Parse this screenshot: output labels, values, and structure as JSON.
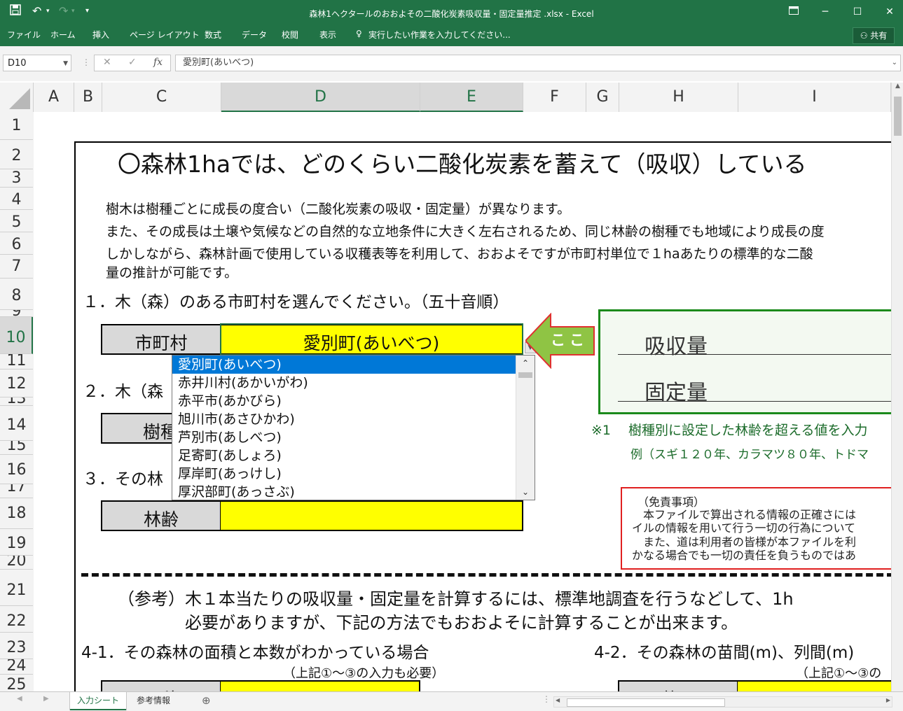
{
  "window": {
    "title": "森林1ヘクタールのおおよその二酸化炭素吸収量・固定量推定 .xlsx - Excel"
  },
  "ribbon": {
    "tabs": [
      "ファイル",
      "ホーム",
      "挿入",
      "ページ レイアウト",
      "数式",
      "データ",
      "校閲",
      "表示"
    ],
    "tell_me": "実行したい作業を入力してください...",
    "share": "共有"
  },
  "formula_bar": {
    "name_box": "D10",
    "content": "愛別町(あいべつ)"
  },
  "columns": [
    "A",
    "B",
    "C",
    "D",
    "E",
    "F",
    "G",
    "H",
    "I"
  ],
  "rows": [
    "1",
    "2",
    "3",
    "4",
    "5",
    "6",
    "7",
    "8",
    "9",
    "10",
    "11",
    "12",
    "13",
    "14",
    "15",
    "16",
    "17",
    "18",
    "19",
    "20",
    "21",
    "22",
    "23",
    "24",
    "25"
  ],
  "selected": {
    "column": "D",
    "row": "10"
  },
  "sheet": {
    "heading": "〇森林1haでは、どのくらい二酸化炭素を蓄えて（吸収）している",
    "intro_1": "樹木は樹種ごとに成長の度合い（二酸化炭素の吸収・固定量）が異なります。",
    "intro_2": "また、その成長は土壌や気候などの自然的な立地条件に大きく左右されるため、同じ林齢の樹種でも地域により成長の度",
    "intro_3": "しかしながら、森林計画で使用している収穫表等を利用して、おおよそですが市町村単位で１haあたりの標準的な二酸",
    "intro_4": "量の推計が可能です。",
    "step1": "１．木（森）のある市町村を選んでください。（五十音順）",
    "label_municipality": "市町村",
    "value_municipality": "愛別町(あいべつ)",
    "arrow_text": "ここ",
    "step2": "２．木（森",
    "label_species": "樹種",
    "step3": "３．その林",
    "label_age": "林齢",
    "result_absorb": "吸収量",
    "result_fixed": "固定量",
    "note1": "※1　 樹種別に設定した林齢を超える値を入力",
    "note2": "例（スギ１２０年、カラマツ８０年、トドマ",
    "disclaimer_title": "（免責事項）",
    "disclaimer_1": "本ファイルで算出される情報の正確さには",
    "disclaimer_2": "イルの情報を用いて行う一切の行為について",
    "disclaimer_3": "また、道は利用者の皆様が本ファイルを利",
    "disclaimer_4": "かなる場合でも一切の責任を負うものではあ",
    "ref_1": "（参考）木１本当たりの吸収量・固定量を計算するには、標準地調査を行うなどして、1h",
    "ref_2": "必要がありますが、下記の方法でもおおよそに計算することが出来ます。",
    "step41": "4-1．その森林の面積と本数がわかっている場合",
    "step41_sub": "（上記①～③の入力も必要）",
    "step42": "4-2．その森林の苗間(m)、列間(m)",
    "step42_sub": "（上記①～③の",
    "label_area": "面積",
    "label_spacing": "苗間"
  },
  "dropdown": {
    "items": [
      "愛別町(あいべつ)",
      "赤井川村(あかいがわ)",
      "赤平市(あかびら)",
      "旭川市(あさひかわ)",
      "芦別市(あしべつ)",
      "足寄町(あしょろ)",
      "厚岸町(あっけし)",
      "厚沢部町(あっさぶ)"
    ],
    "selected_index": 0
  },
  "sheet_tabs": [
    "入力シート",
    "参考情報"
  ],
  "active_sheet": "入力シート",
  "colors": {
    "excel_green": "#217346",
    "input_yellow": "#ffff00",
    "label_gray": "#d9d9d9",
    "arrow_green": "#8fc444",
    "result_border": "#1b8a1b",
    "disclaimer_border": "#e02020",
    "dropdown_selection": "#0078d7"
  }
}
